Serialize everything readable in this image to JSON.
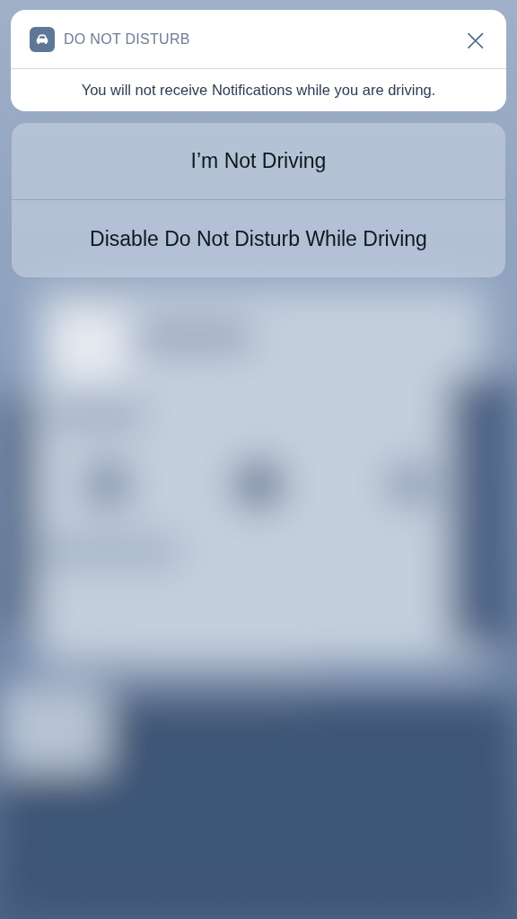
{
  "notification": {
    "app_name": "DO NOT DISTURB",
    "close_symbol": "×",
    "message": "You will not receive Notifications while you are driving."
  },
  "actions": [
    {
      "label": "I’m Not Driving"
    },
    {
      "label": "Disable Do Not Disturb While Driving"
    }
  ]
}
